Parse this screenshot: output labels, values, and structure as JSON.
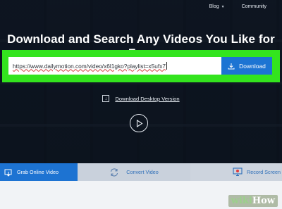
{
  "nav": {
    "blog": "Blog",
    "community": "Community"
  },
  "hero": {
    "title": "Download and Search Any Videos You Like for Free"
  },
  "search": {
    "url_value": "https://www.dailymotion.com/video/x6l1gko?playlist=x5ufx7",
    "download_label": "Download"
  },
  "desktop": {
    "label": "Download Desktop Version"
  },
  "tabs": [
    {
      "label": "Grab Online Video",
      "icon": "grab-video-icon"
    },
    {
      "label": "Convert Video",
      "icon": "convert-icon"
    },
    {
      "label": "Record Screen",
      "icon": "record-screen-icon"
    }
  ],
  "watermark": {
    "wiki": "wiki",
    "how": "How"
  },
  "colors": {
    "highlight": "#33e41e",
    "accent": "#1c74d3"
  }
}
